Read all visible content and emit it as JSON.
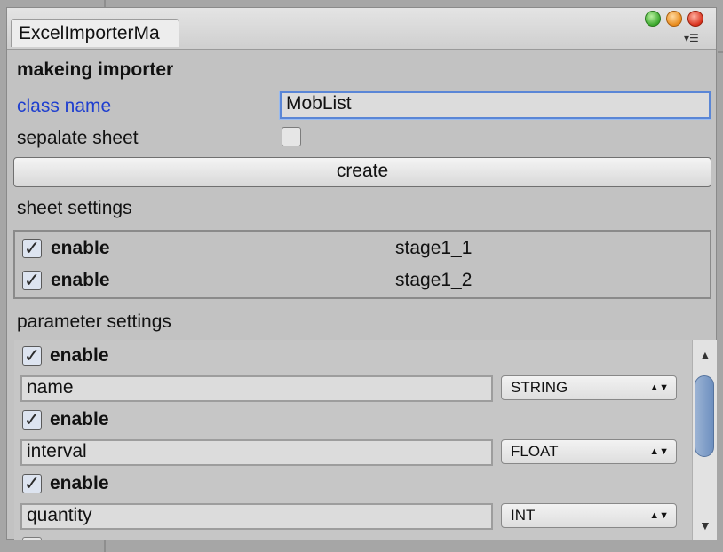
{
  "window": {
    "tab_title": "ExcelImporterMa",
    "menu_icon": "list-menu-icon"
  },
  "form": {
    "heading": "makeing importer",
    "class_name_label": "class name",
    "class_name_value": "MobList",
    "separate_sheet_label": "sepalate sheet",
    "separate_sheet_checked": false,
    "create_label": "create"
  },
  "sheet_settings": {
    "heading": "sheet settings",
    "items": [
      {
        "enable_label": "enable",
        "checked": true,
        "name": "stage1_1"
      },
      {
        "enable_label": "enable",
        "checked": true,
        "name": "stage1_2"
      }
    ]
  },
  "parameter_settings": {
    "heading": "parameter settings",
    "items": [
      {
        "enable_label": "enable",
        "checked": true,
        "name": "name",
        "type": "STRING"
      },
      {
        "enable_label": "enable",
        "checked": true,
        "name": "interval",
        "type": "FLOAT"
      },
      {
        "enable_label": "enable",
        "checked": true,
        "name": "quantity",
        "type": "INT"
      }
    ],
    "next_checked": false
  },
  "glyphs": {
    "check": "✓",
    "select_arrows": "▲▼",
    "scroll_up": "▲",
    "scroll_down": "▼"
  },
  "colors": {
    "label_blue": "#1f3fcf",
    "window_bg": "#c2c2c2",
    "scroll_thumb": "#6d8fbf"
  }
}
